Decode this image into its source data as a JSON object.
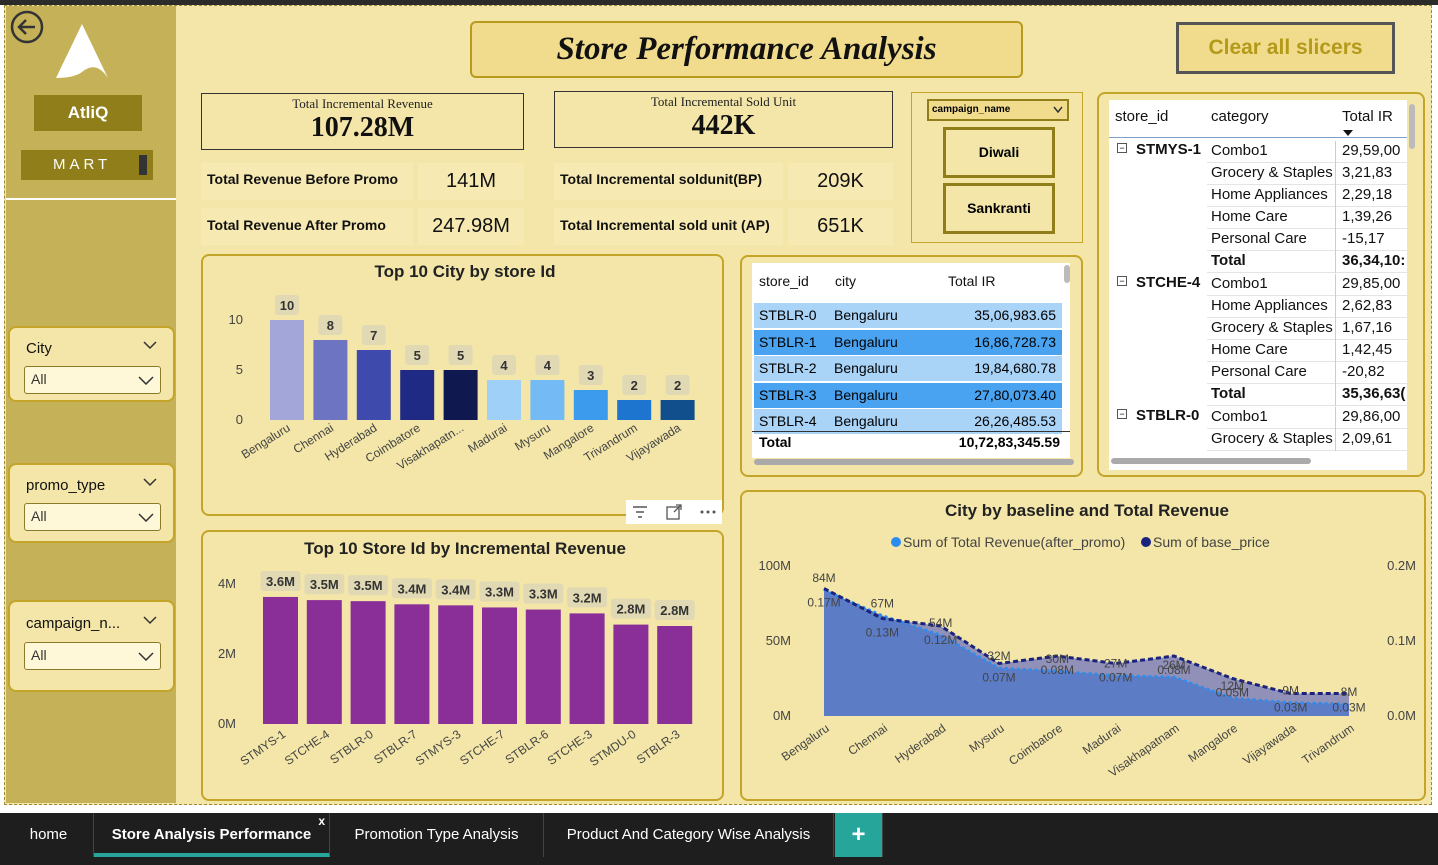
{
  "brand": {
    "name": "AtliQ",
    "sub": "MART"
  },
  "title": "Store Performance Analysis",
  "clear_button": "Clear all slicers",
  "kpis": {
    "inc_rev": {
      "label": "Total Incremental Revenue",
      "value": "107.28M"
    },
    "inc_units": {
      "label": "Total Incremental Sold Unit",
      "value": "442K"
    },
    "rev_bp": {
      "label": "Total Revenue Before Promo",
      "value": "141M"
    },
    "rev_ap": {
      "label": "Total Revenue After Promo",
      "value": "247.98M"
    },
    "units_bp": {
      "label": "Total Incremental soldunit(BP)",
      "value": "209K"
    },
    "units_ap": {
      "label": "Total Incremental sold unit (AP)",
      "value": "651K"
    }
  },
  "campaign": {
    "dropdown": "campaign_name",
    "options": [
      "Diwali",
      "Sankranti"
    ]
  },
  "slicers": [
    {
      "title": "City",
      "value": "All"
    },
    {
      "title": "promo_type",
      "value": "All"
    },
    {
      "title": "campaign_n...",
      "value": "All"
    }
  ],
  "matrix": {
    "headers": [
      "store_id",
      "category",
      "Total IR"
    ],
    "groups": [
      {
        "store": "STMYS-1",
        "rows": [
          [
            "Combo1",
            "29,59,00"
          ],
          [
            "Grocery & Staples",
            "3,21,83"
          ],
          [
            "Home Appliances",
            "2,29,18"
          ],
          [
            "Home Care",
            "1,39,26"
          ],
          [
            "Personal Care",
            "-15,17"
          ],
          [
            "Total",
            "36,34,10:"
          ]
        ]
      },
      {
        "store": "STCHE-4",
        "rows": [
          [
            "Combo1",
            "29,85,00"
          ],
          [
            "Home Appliances",
            "2,62,83"
          ],
          [
            "Grocery & Staples",
            "1,67,16"
          ],
          [
            "Home Care",
            "1,42,45"
          ],
          [
            "Personal Care",
            "-20,82"
          ],
          [
            "Total",
            "35,36,63("
          ]
        ]
      },
      {
        "store": "STBLR-0",
        "rows": [
          [
            "Combo1",
            "29,86,00"
          ],
          [
            "Grocery & Staples",
            "2,09,61"
          ]
        ]
      }
    ]
  },
  "city_table": {
    "headers": [
      "store_id",
      "city",
      "Total IR"
    ],
    "rows": [
      [
        "STBLR-0",
        "Bengaluru",
        "35,06,983.65"
      ],
      [
        "STBLR-1",
        "Bengaluru",
        "16,86,728.73"
      ],
      [
        "STBLR-2",
        "Bengaluru",
        "19,84,680.78"
      ],
      [
        "STBLR-3",
        "Bengaluru",
        "27,80,073.40"
      ],
      [
        "STBLR-4",
        "Bengaluru",
        "26,26,485.53"
      ]
    ],
    "total_label": "Total",
    "total_value": "10,72,83,345.59"
  },
  "chart_data": [
    {
      "type": "bar",
      "title": "Top 10 City by store Id",
      "categories": [
        "Bengaluru",
        "Chennai",
        "Hyderabad",
        "Coimbatore",
        "Visakhapatn...",
        "Madurai",
        "Mysuru",
        "Mangalore",
        "Trivandrum",
        "Vijayawada"
      ],
      "values": [
        10,
        8,
        7,
        5,
        5,
        4,
        4,
        3,
        2,
        2
      ],
      "colors": [
        "#a3a6d8",
        "#6d74c2",
        "#3f4aad",
        "#1f2a85",
        "#101850",
        "#9fd0f7",
        "#74baf4",
        "#3d9bee",
        "#1e75d0",
        "#114f8c"
      ],
      "yticks": [
        0,
        5,
        10
      ],
      "ylim": [
        0,
        11
      ]
    },
    {
      "type": "bar",
      "title": "Top 10 Store Id by Incremental Revenue",
      "categories": [
        "STMYS-1",
        "STCHE-4",
        "STBLR-0",
        "STBLR-7",
        "STMYS-3",
        "STCHE-7",
        "STBLR-6",
        "STCHE-3",
        "STMDU-0",
        "STBLR-3"
      ],
      "values": [
        3.63,
        3.54,
        3.51,
        3.42,
        3.39,
        3.33,
        3.27,
        3.16,
        2.84,
        2.8
      ],
      "labels": [
        "3.6M",
        "3.5M",
        "3.5M",
        "3.4M",
        "3.4M",
        "3.3M",
        "3.3M",
        "3.2M",
        "2.8M",
        "2.8M"
      ],
      "color": "#8a2f98",
      "yticks": [
        "0M",
        "2M",
        "4M"
      ],
      "ylim": [
        0,
        4.4
      ]
    },
    {
      "type": "area",
      "title": "City by baseline and Total Revenue",
      "categories": [
        "Bengaluru",
        "Chennai",
        "Hyderabad",
        "Mysuru",
        "Coimbatore",
        "Madurai",
        "Visakhapatnam",
        "Mangalore",
        "Vijayawada",
        "Trivandrum"
      ],
      "series": [
        {
          "name": "Sum of Total Revenue(after_promo)",
          "values": [
            84,
            67,
            54,
            32,
            30,
            27,
            26,
            12,
            9,
            8
          ],
          "labels": [
            "84M",
            "67M",
            "54M",
            "32M",
            "30M",
            "27M",
            "26M",
            "12M",
            "9M",
            "8M"
          ],
          "color": "#2b8df0"
        },
        {
          "name": "Sum of base_price",
          "values": [
            0.17,
            0.13,
            0.12,
            0.07,
            0.08,
            0.07,
            0.08,
            0.05,
            0.03,
            0.03
          ],
          "labels": [
            "0.17M",
            "0.13M",
            "0.12M",
            "0.07M",
            "0.08M",
            "0.07M",
            "0.08M",
            "0.05M",
            "0.03M",
            "0.03M"
          ],
          "color": "#1a237e"
        }
      ],
      "yticks_left": [
        "0M",
        "50M",
        "100M"
      ],
      "yticks_right": [
        "0.0M",
        "0.1M",
        "0.2M"
      ],
      "ylim_left": [
        0,
        100
      ],
      "ylim_right": [
        0,
        0.2
      ]
    }
  ],
  "tabs": [
    {
      "label": "home"
    },
    {
      "label": "Store Analysis Performance",
      "close": "x"
    },
    {
      "label": "Promotion Type Analysis"
    },
    {
      "label": "Product And Category Wise Analysis"
    }
  ],
  "add_tab": "+"
}
